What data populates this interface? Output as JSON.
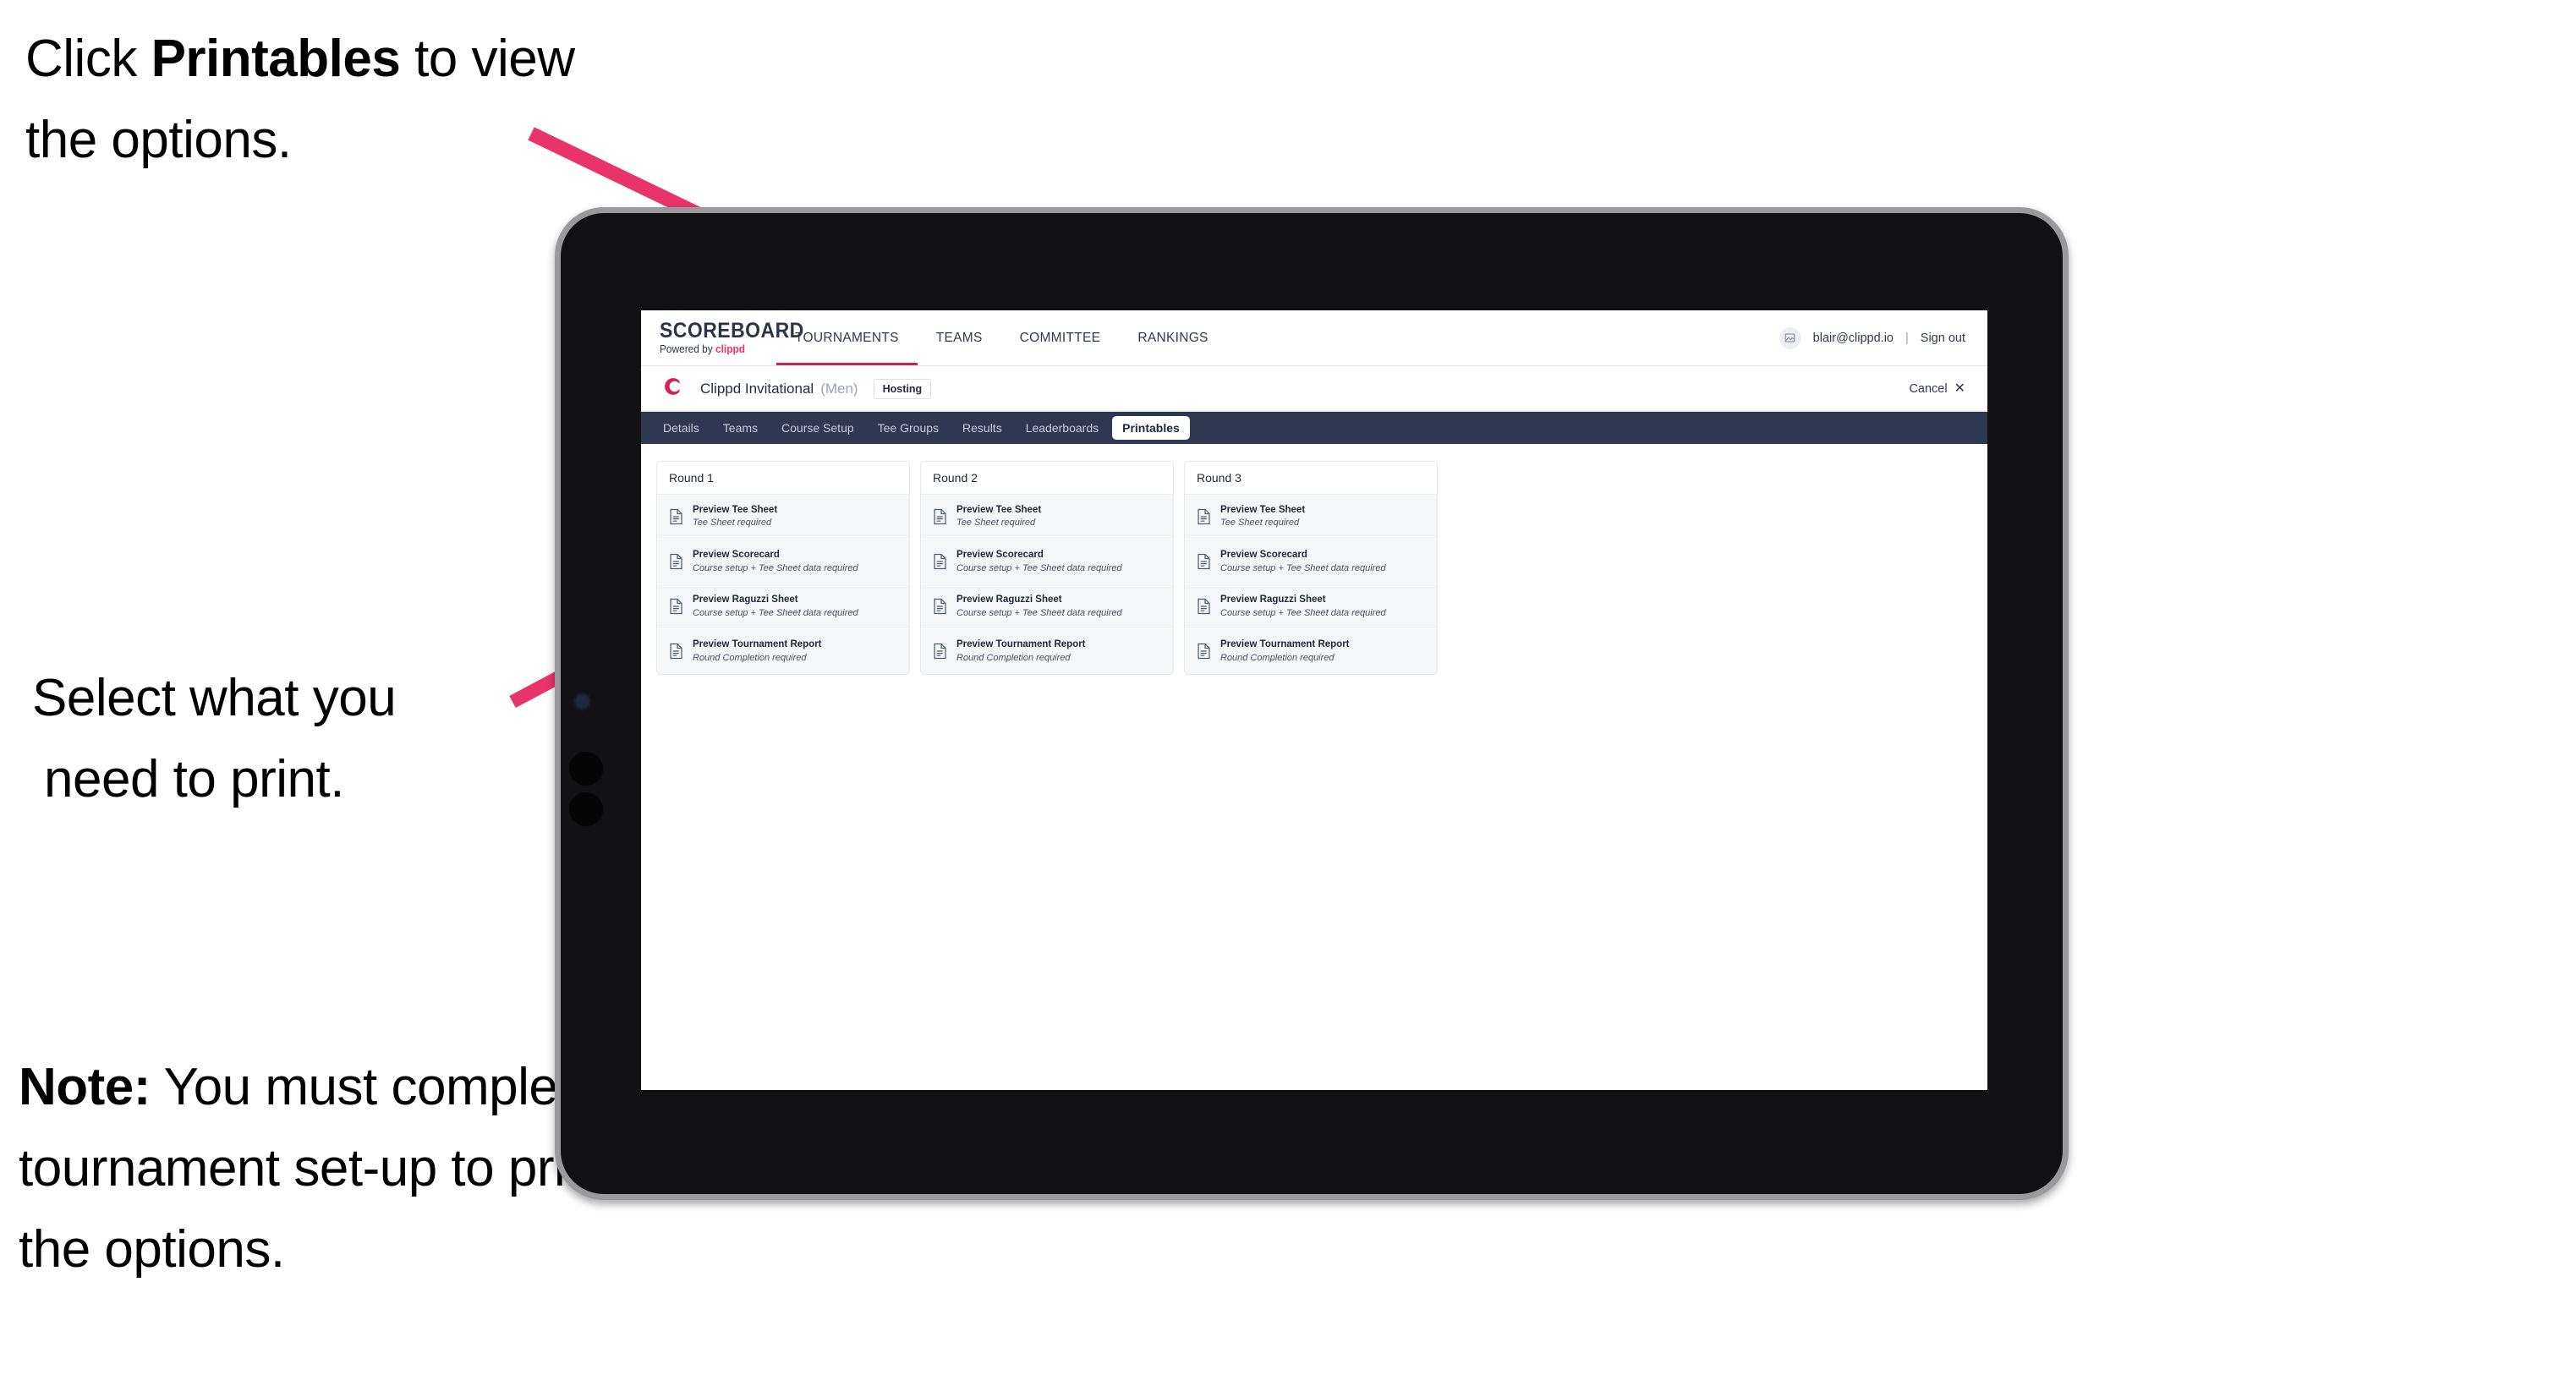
{
  "annotations": {
    "click_printables": {
      "pre": "Click ",
      "bold": "Printables",
      "post": " to view the options."
    },
    "select_print": {
      "line1": "Select what you",
      "line2": "need to print."
    },
    "note": {
      "bold": "Note:",
      "text": " You must complete the tournament set-up to print all the options."
    }
  },
  "colors": {
    "arrow_pink": "#e8346b",
    "brand_pink": "#d4225c",
    "tabbar_navy": "#2e3850",
    "logo_navy": "#2c3448"
  },
  "app": {
    "logo": {
      "main": "SCOREBOARD",
      "sub_pre": "Powered by ",
      "sub_brand": "clippd"
    },
    "topnav": {
      "items": [
        {
          "label": "TOURNAMENTS",
          "active": true
        },
        {
          "label": "TEAMS",
          "active": false
        },
        {
          "label": "COMMITTEE",
          "active": false
        },
        {
          "label": "RANKINGS",
          "active": false
        }
      ],
      "avatar_icon": "user-avatar-icon",
      "user_email": "blair@clippd.io",
      "separator": "|",
      "sign_out": "Sign out"
    },
    "tournament_bar": {
      "logo_letter": "C",
      "name": "Clippd Invitational",
      "gender": "(Men)",
      "badge": "Hosting",
      "cancel_label": "Cancel",
      "cancel_icon": "✕"
    },
    "tabs": [
      {
        "label": "Details",
        "active": false
      },
      {
        "label": "Teams",
        "active": false
      },
      {
        "label": "Course Setup",
        "active": false
      },
      {
        "label": "Tee Groups",
        "active": false
      },
      {
        "label": "Results",
        "active": false
      },
      {
        "label": "Leaderboards",
        "active": false
      },
      {
        "label": "Printables",
        "active": true
      }
    ],
    "printables": {
      "rounds": [
        {
          "header": "Round 1",
          "items": [
            {
              "title": "Preview Tee Sheet",
              "requirement": "Tee Sheet required"
            },
            {
              "title": "Preview Scorecard",
              "requirement": "Course setup + Tee Sheet data required"
            },
            {
              "title": "Preview Raguzzi Sheet",
              "requirement": "Course setup + Tee Sheet data required"
            },
            {
              "title": "Preview Tournament Report",
              "requirement": "Round Completion required"
            }
          ]
        },
        {
          "header": "Round 2",
          "items": [
            {
              "title": "Preview Tee Sheet",
              "requirement": "Tee Sheet required"
            },
            {
              "title": "Preview Scorecard",
              "requirement": "Course setup + Tee Sheet data required"
            },
            {
              "title": "Preview Raguzzi Sheet",
              "requirement": "Course setup + Tee Sheet data required"
            },
            {
              "title": "Preview Tournament Report",
              "requirement": "Round Completion required"
            }
          ]
        },
        {
          "header": "Round 3",
          "items": [
            {
              "title": "Preview Tee Sheet",
              "requirement": "Tee Sheet required"
            },
            {
              "title": "Preview Scorecard",
              "requirement": "Course setup + Tee Sheet data required"
            },
            {
              "title": "Preview Raguzzi Sheet",
              "requirement": "Course setup + Tee Sheet data required"
            },
            {
              "title": "Preview Tournament Report",
              "requirement": "Round Completion required"
            }
          ]
        }
      ]
    }
  }
}
